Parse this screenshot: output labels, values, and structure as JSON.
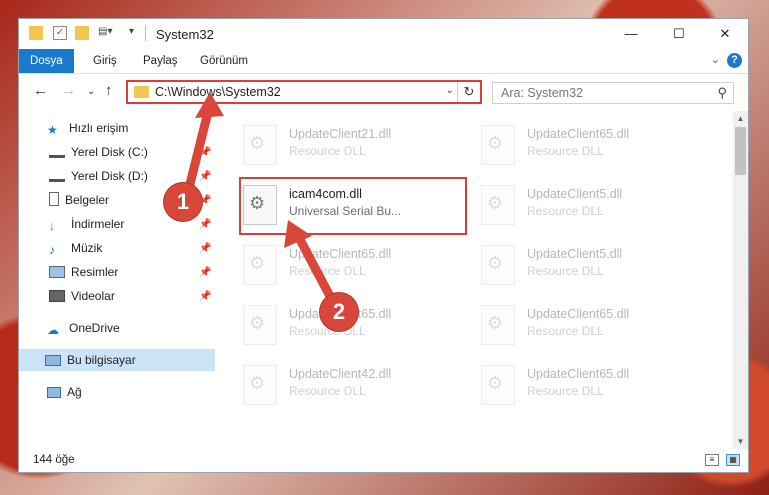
{
  "window": {
    "title": "System32"
  },
  "titlebar": {
    "minimize": "—",
    "maximize": "☐",
    "close": "✕"
  },
  "ribbon": {
    "tabs": [
      "Dosya",
      "Giriş",
      "Paylaş",
      "Görünüm"
    ],
    "help": "?"
  },
  "address": {
    "path": "C:\\Windows\\System32"
  },
  "search": {
    "placeholder": "Ara: System32"
  },
  "navpane": {
    "items": [
      {
        "label": "Hızlı erişim"
      },
      {
        "label": "Yerel Disk (C:)"
      },
      {
        "label": "Yerel Disk (D:)"
      },
      {
        "label": "Belgeler"
      },
      {
        "label": "İndirmeler"
      },
      {
        "label": "Müzik"
      },
      {
        "label": "Resimler"
      },
      {
        "label": "Videolar"
      },
      {
        "label": "OneDrive"
      },
      {
        "label": "Bu bilgisayar"
      },
      {
        "label": "Ağ"
      }
    ]
  },
  "files": [
    {
      "name": "UpdateClient21.dll",
      "type": "Resource DLL"
    },
    {
      "name": "UpdateClient65.dll",
      "type": "Resource DLL"
    },
    {
      "name": "icam4com.dll",
      "type": "Universal Serial Bu..."
    },
    {
      "name": "UpdateClient5.dll",
      "type": "Resource DLL"
    },
    {
      "name": "UpdateClient65.dll",
      "type": "Resource DLL"
    },
    {
      "name": "UpdateClient5.dll",
      "type": "Resource DLL"
    },
    {
      "name": "UpdateClient65.dll",
      "type": "Resource DLL"
    },
    {
      "name": "UpdateClient65.dll",
      "type": "Resource DLL"
    },
    {
      "name": "UpdateClient42.dll",
      "type": "Resource DLL"
    },
    {
      "name": "UpdateClient65.dll",
      "type": "Resource DLL"
    }
  ],
  "status": {
    "count": "144 öğe"
  },
  "annotations": {
    "step1": "1",
    "step2": "2"
  },
  "colors": {
    "accent": "#1979ca",
    "highlight": "#e03a3a",
    "badge": "#d9473a"
  }
}
